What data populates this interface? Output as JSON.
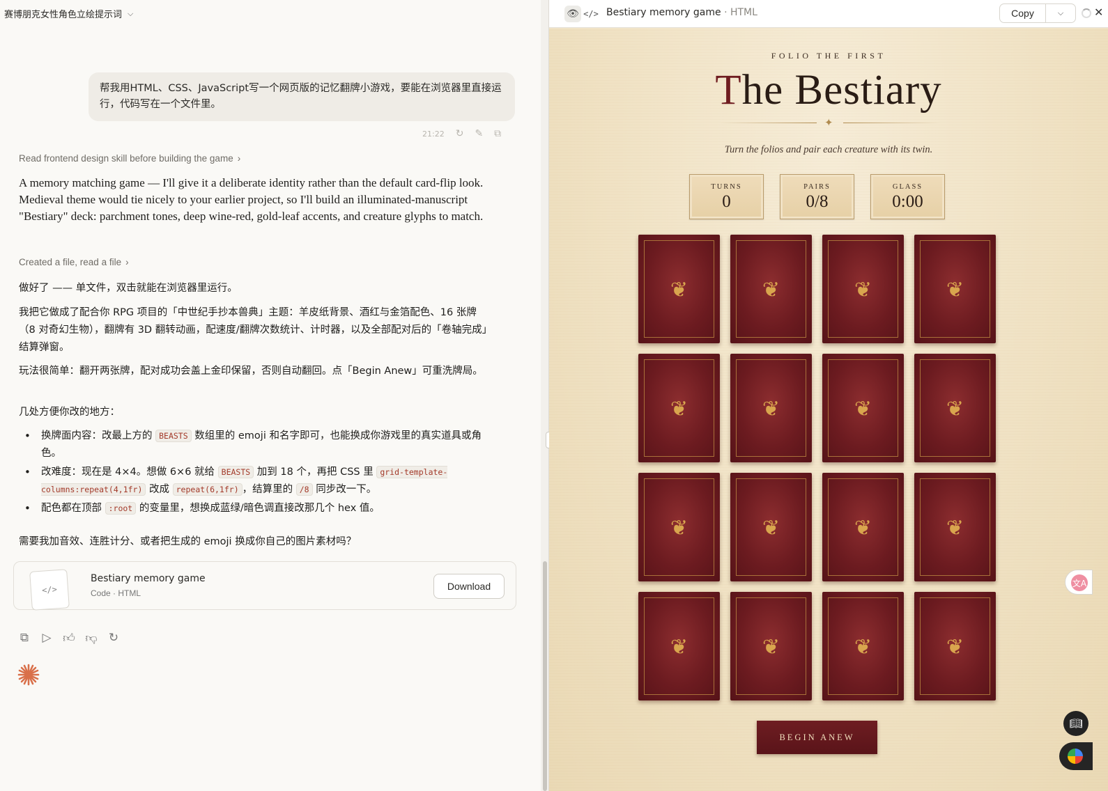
{
  "conversation": {
    "title": "赛博朋克女性角色立绘提示词"
  },
  "user_message": {
    "text": "帮我用HTML、CSS、JavaScript写一个网页版的记忆翻牌小游戏，要能在浏览器里直接运行，代码写在一个文件里。",
    "time": "21:22"
  },
  "assistant": {
    "step1": "Read frontend design skill before building the game",
    "intro": "A memory matching game — I'll give it a deliberate identity rather than the default card-flip look. Medieval theme would tie nicely to your earlier project, so I'll build an illuminated-manuscript \"Bestiary\" deck: parchment tones, deep wine-red, gold-leaf accents, and creature glyphs to match.",
    "step2": "Created a file, read a file",
    "p1": "做好了 —— 单文件，双击就能在浏览器里运行。",
    "p2": "我把它做成了配合你 RPG 项目的「中世纪手抄本兽典」主题：羊皮纸背景、酒红与金箔配色、16 张牌（8 对奇幻生物），翻牌有 3D 翻转动画，配速度/翻牌次数统计、计时器，以及全部配对后的「卷轴完成」结算弹窗。",
    "p3": "玩法很简单：翻开两张牌，配对成功会盖上金印保留，否则自动翻回。点「Begin Anew」可重洗牌局。",
    "p4": "几处方便你改的地方：",
    "li1_a": "换牌面内容：改最上方的",
    "li1_code": "BEASTS",
    "li1_b": "数组里的 emoji 和名字即可，也能换成你游戏里的真实道具或角色。",
    "li2_a": "改难度：现在是 4×4。想做 6×6 就给",
    "li2_code1": "BEASTS",
    "li2_b": "加到 18 个，再把 CSS 里",
    "li2_code2": "grid-template-columns:repeat(4,1fr)",
    "li2_c": "改成",
    "li2_code3": "repeat(6,1fr)",
    "li2_d": "，结算里的",
    "li2_code4": "/8",
    "li2_e": "同步改一下。",
    "li3_a": "配色都在顶部",
    "li3_code": ":root",
    "li3_b": "的变量里，想换成蓝绿/暗色调直接改那几个 hex 值。",
    "closing": "需要我加音效、连胜计分、或者把生成的 emoji 换成你自己的图片素材吗？"
  },
  "artifact": {
    "title": "Bestiary memory game",
    "subtitle": "Code · HTML",
    "download_label": "Download"
  },
  "preview": {
    "title": "Bestiary memory game",
    "type": "· HTML",
    "copy_label": "Copy"
  },
  "game": {
    "folio": "FOLIO THE FIRST",
    "title_drop": "T",
    "title_rest": "he Bestiary",
    "subtitle": "Turn the folios and pair each creature with its twin.",
    "stats": [
      {
        "label": "TURNS",
        "value": "0"
      },
      {
        "label": "PAIRS",
        "value": "0/8"
      },
      {
        "label": "GLASS",
        "value": "0:00"
      }
    ],
    "card_glyph": "❦",
    "begin_label": "BEGIN ANEW"
  }
}
